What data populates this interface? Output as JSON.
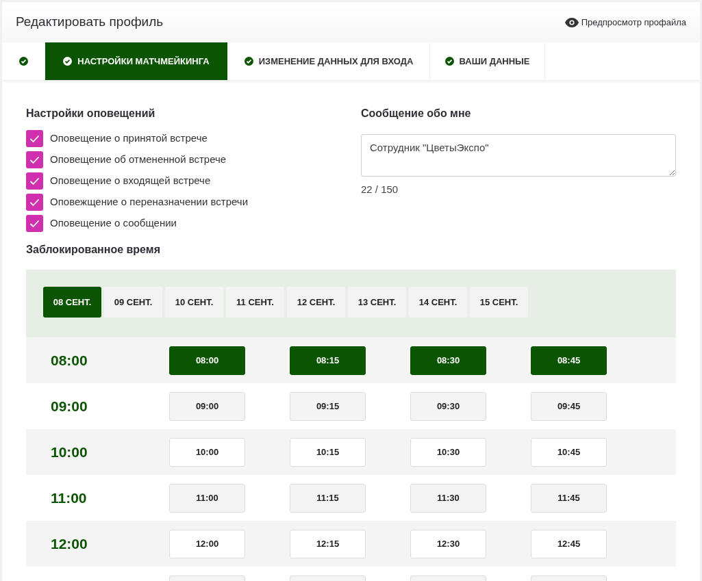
{
  "header": {
    "title": "Редактировать профиль",
    "preview_link": "Предпросмотр профайла"
  },
  "tabs": [
    {
      "selected": false
    },
    {
      "label": "НАСТРОЙКИ МАТЧМЕЙКИНГА",
      "selected": true
    },
    {
      "label": "ИЗМЕНЕНИЕ ДАННЫХ ДЛЯ ВХОДА",
      "selected": false
    },
    {
      "label": "ВАШИ ДАННЫЕ",
      "selected": false
    }
  ],
  "notifications": {
    "title": "Настройки оповещений",
    "items": [
      {
        "label": "Оповещение о принятой встрече",
        "checked": true
      },
      {
        "label": "Оповещение об отмененной встрече",
        "checked": true
      },
      {
        "label": "Оповещение о входящей встрече",
        "checked": true
      },
      {
        "label": "Оповежщение о переназначении встречи",
        "checked": true
      },
      {
        "label": "Оповещение о сообщении",
        "checked": true
      }
    ]
  },
  "about": {
    "title": "Сообщение обо мне",
    "value": "Сотрудник \"ЦветыЭкспо\"",
    "counter": "22 / 150"
  },
  "blocked_time": {
    "title": "Заблокированное время",
    "dates": [
      {
        "label": "08 СЕНТ.",
        "selected": true
      },
      {
        "label": "09 СЕНТ.",
        "selected": false
      },
      {
        "label": "10 СЕНТ.",
        "selected": false
      },
      {
        "label": "11 СЕНТ.",
        "selected": false
      },
      {
        "label": "12 СЕНТ.",
        "selected": false
      },
      {
        "label": "13 СЕНТ.",
        "selected": false
      },
      {
        "label": "14 СЕНТ.",
        "selected": false
      },
      {
        "label": "15 СЕНТ.",
        "selected": false
      }
    ],
    "rows": [
      {
        "hour": "08:00",
        "slots": [
          {
            "label": "08:00",
            "selected": true
          },
          {
            "label": "08:15",
            "selected": true
          },
          {
            "label": "08:30",
            "selected": true
          },
          {
            "label": "08:45",
            "selected": true
          }
        ]
      },
      {
        "hour": "09:00",
        "slots": [
          {
            "label": "09:00",
            "selected": false
          },
          {
            "label": "09:15",
            "selected": false
          },
          {
            "label": "09:30",
            "selected": false
          },
          {
            "label": "09:45",
            "selected": false
          }
        ]
      },
      {
        "hour": "10:00",
        "slots": [
          {
            "label": "10:00",
            "selected": false
          },
          {
            "label": "10:15",
            "selected": false
          },
          {
            "label": "10:30",
            "selected": false
          },
          {
            "label": "10:45",
            "selected": false
          }
        ]
      },
      {
        "hour": "11:00",
        "slots": [
          {
            "label": "11:00",
            "selected": false
          },
          {
            "label": "11:15",
            "selected": false
          },
          {
            "label": "11:30",
            "selected": false
          },
          {
            "label": "11:45",
            "selected": false
          }
        ]
      },
      {
        "hour": "12:00",
        "slots": [
          {
            "label": "12:00",
            "selected": false
          },
          {
            "label": "12:15",
            "selected": false
          },
          {
            "label": "12:30",
            "selected": false
          },
          {
            "label": "12:45",
            "selected": false
          }
        ]
      },
      {
        "slots": [
          {
            "selected": false
          },
          {
            "selected": false
          },
          {
            "selected": false
          },
          {
            "selected": false
          }
        ]
      }
    ]
  }
}
